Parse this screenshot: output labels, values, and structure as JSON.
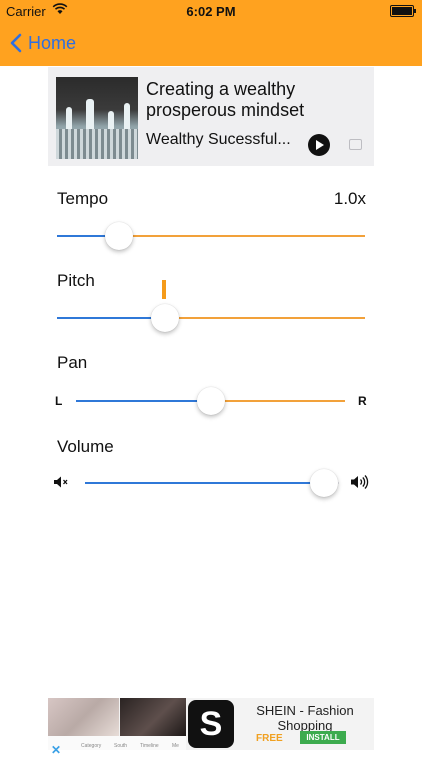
{
  "status_bar": {
    "carrier": "Carrier",
    "time": "6:02 PM"
  },
  "nav": {
    "back_label": "Home"
  },
  "now_playing": {
    "title": "Creating a wealthy prosperous mindset",
    "artist": "Wealthy Sucessful..."
  },
  "controls": {
    "tempo": {
      "label": "Tempo",
      "value_text": "1.0x",
      "level": 0.2
    },
    "pitch": {
      "label": "Pitch",
      "level": 0.35
    },
    "pan": {
      "label": "Pan",
      "left": "L",
      "right": "R",
      "level": 0.5
    },
    "volume": {
      "label": "Volume",
      "level": 0.94
    }
  },
  "ad": {
    "title": "SHEIN - Fashion Shopping",
    "free": "FREE",
    "install": "INSTALL",
    "logo_letter": "S",
    "nav_items": [
      "Category",
      "South",
      "Timeline",
      "Me"
    ]
  },
  "colors": {
    "accent": "#ffa21f",
    "slider_min_track": "#2f78d8",
    "slider_max_track": "#f2a13a",
    "back_link": "#2f6fe0"
  }
}
